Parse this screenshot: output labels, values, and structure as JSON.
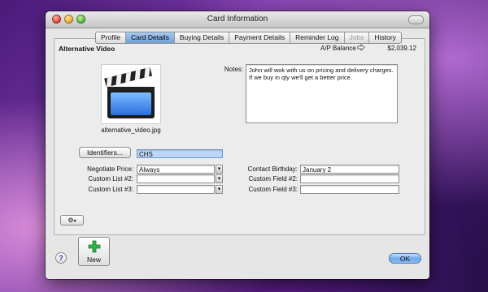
{
  "window": {
    "title": "Card Information"
  },
  "tabs": [
    {
      "label": "Profile",
      "state": "normal"
    },
    {
      "label": "Card Details",
      "state": "active"
    },
    {
      "label": "Buying Details",
      "state": "normal"
    },
    {
      "label": "Payment Details",
      "state": "normal"
    },
    {
      "label": "Reminder Log",
      "state": "normal"
    },
    {
      "label": "Jobs",
      "state": "disabled"
    },
    {
      "label": "History",
      "state": "normal"
    }
  ],
  "card": {
    "name": "Alternative Video",
    "ap_balance_label": "A/P Balance",
    "ap_balance_value": "$2,039.12",
    "image_caption": "alternative_video.jpg"
  },
  "notes": {
    "label": "Notes:",
    "text": "John will wok with us on pricing and delivery charges.  If we buy in qty we'll get a better price."
  },
  "identifiers": {
    "button_label": "Identifiers...",
    "value": "CHS"
  },
  "left_fields": [
    {
      "label": "Negotiate Price:",
      "value": "Always"
    },
    {
      "label": "Custom List #2:",
      "value": ""
    },
    {
      "label": "Custom List #3:",
      "value": ""
    }
  ],
  "right_fields": [
    {
      "label": "Contact Birthday:",
      "value": "January 2"
    },
    {
      "label": "Custom Field #2:",
      "value": ""
    },
    {
      "label": "Custom Field #3:",
      "value": ""
    }
  ],
  "footer": {
    "help_label": "?",
    "new_label": "New",
    "ok_label": "OK"
  },
  "colors": {
    "tab_active": "#7fa9dc",
    "identifier_highlight": "#bcd6f5",
    "ok_button": "#6fa8ea",
    "new_plus": "#2fb24a"
  },
  "icons": [
    "clapperboard-icon",
    "arrow-right-icon",
    "gear-icon",
    "plus-icon",
    "help-icon"
  ]
}
